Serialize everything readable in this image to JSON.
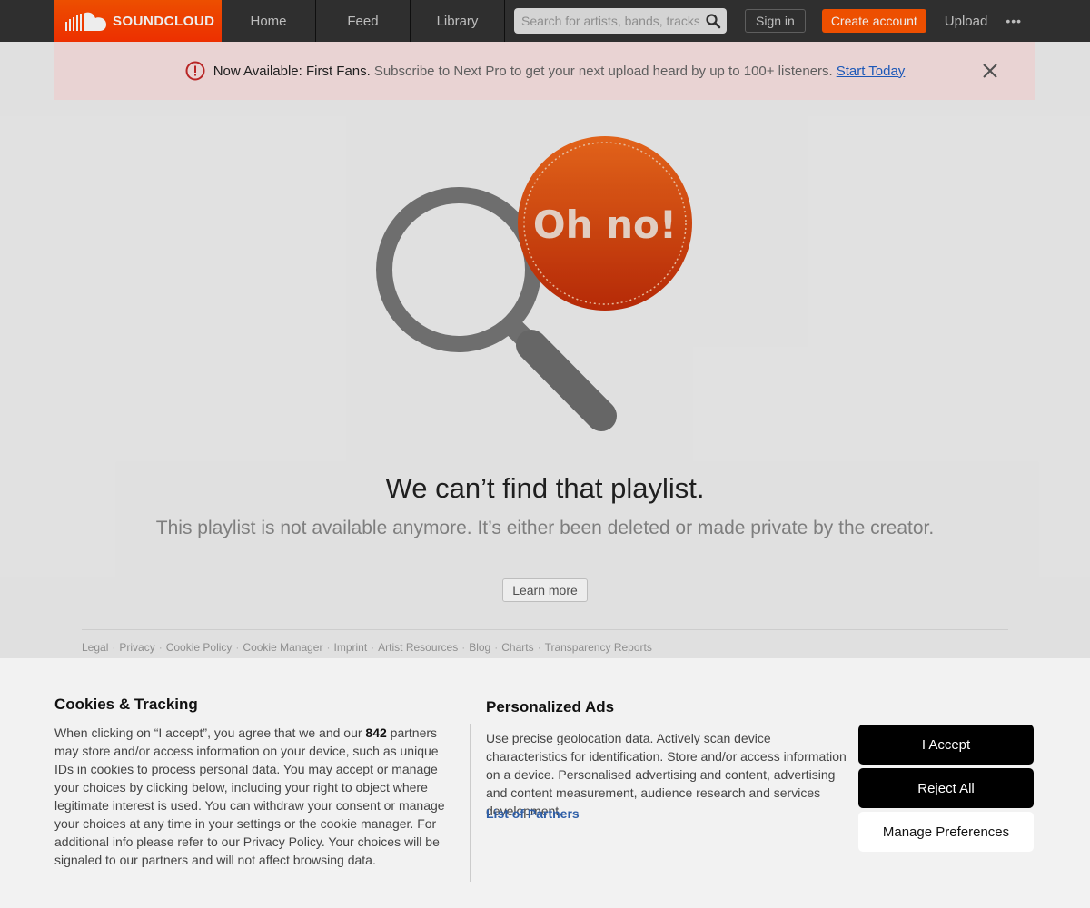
{
  "header": {
    "logo_text": "SOUNDCLOUD",
    "nav": [
      "Home",
      "Feed",
      "Library"
    ],
    "search_placeholder": "Search for artists, bands, tracks, podcasts",
    "sign_in": "Sign in",
    "create_account": "Create account",
    "upload": "Upload",
    "more": "•••",
    "accent": "#ff5500"
  },
  "banner": {
    "strong": "Now Available: First Fans.",
    "text": "Subscribe to Next Pro to get your next upload heard by up to 100+ listeners.",
    "link": "Start Today"
  },
  "main": {
    "badge_text": "Oh no!",
    "title": "We can’t find that playlist.",
    "subtitle": "This playlist is not available anymore. It’s either been deleted or made private by the creator.",
    "learn_more": "Learn more"
  },
  "footer": {
    "links": [
      "Legal",
      "Privacy",
      "Cookie Policy",
      "Cookie Manager",
      "Imprint",
      "Artist Resources",
      "Blog",
      "Charts",
      "Transparency Reports"
    ]
  },
  "cookie": {
    "title": "Cookies & Tracking",
    "body_pre": "When clicking on “I accept”, you agree that we and our ",
    "partner_count": "842",
    "body_post": " partners may store and/or access information on your device, such as unique IDs in cookies to process personal data. You may accept or manage your choices by clicking below, including your right to object where legitimate interest is used. You can withdraw your consent or manage your choices at any time in your settings or the cookie manager. For additional info please refer to our Privacy Policy. Your choices will be signaled to our partners and will not affect browsing data.",
    "ads_title": "Personalized Ads",
    "ads_body": "Use precise geolocation data. Actively scan device characteristics for identification. Store and/or access information on a device. Personalised advertising and content, advertising and content measurement, audience research and services development.",
    "partners_link": "List of Partners",
    "accept": "I Accept",
    "reject": "Reject All",
    "manage": "Manage Preferences"
  }
}
